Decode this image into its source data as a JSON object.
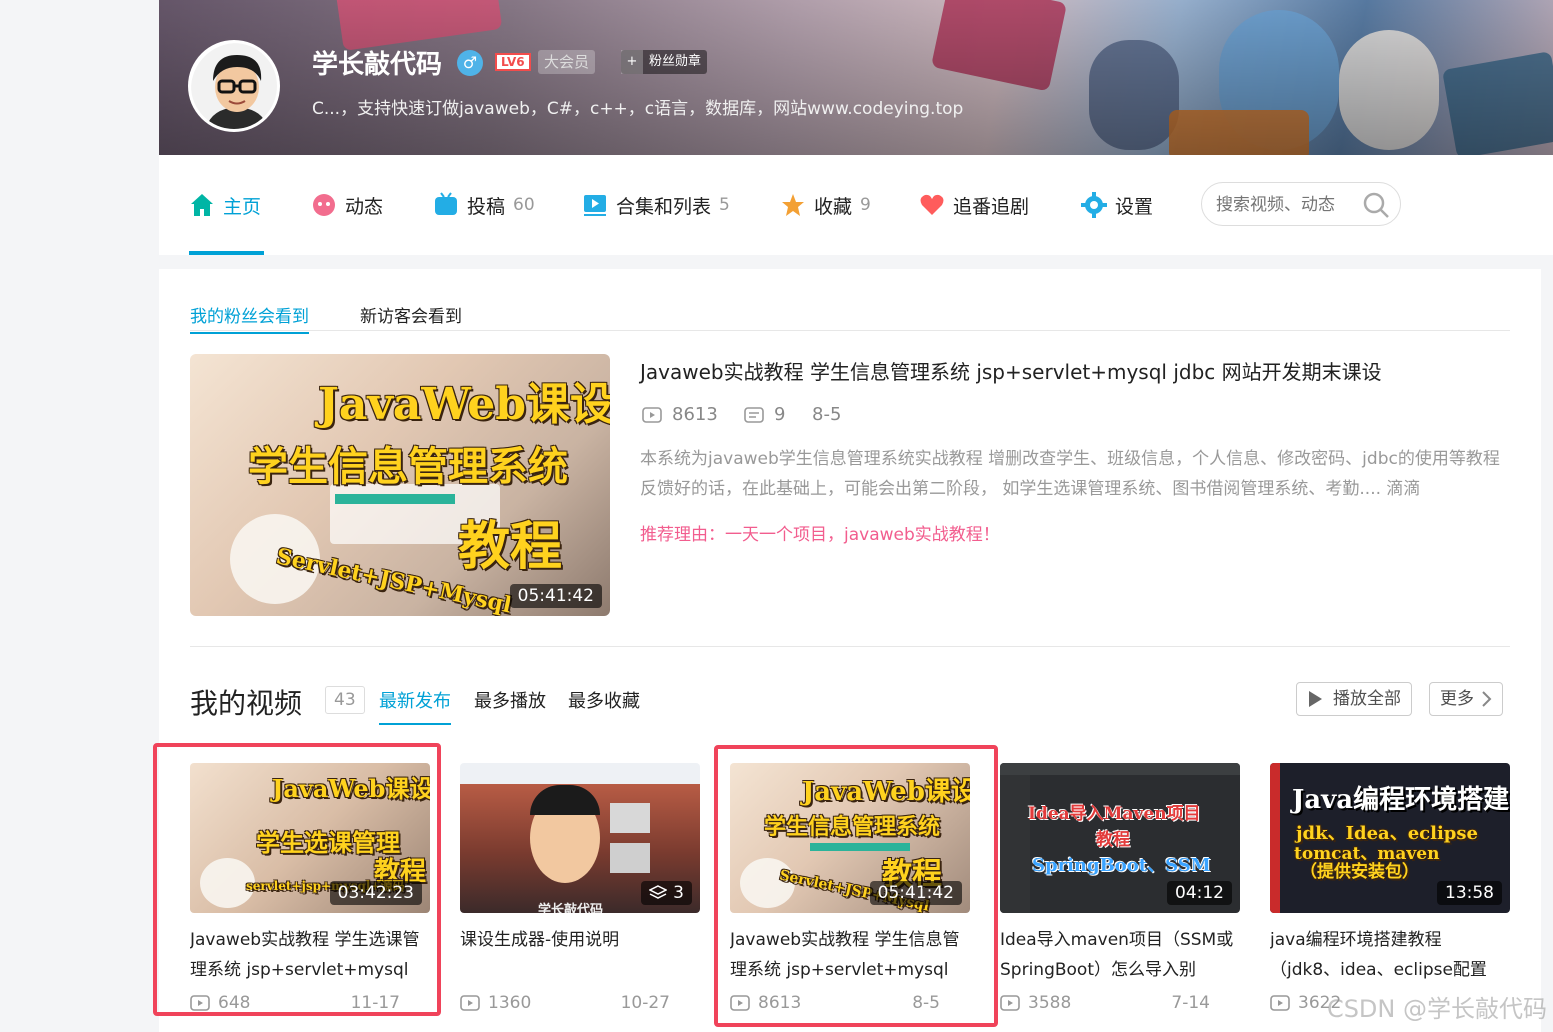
{
  "profile": {
    "username": "学长敲代码",
    "gender_icon": "♂",
    "level_badge": "LV6",
    "vip_badge": "大会员",
    "fans_badge_plus": "+",
    "fans_badge": "粉丝勋章",
    "signature": "C...，支持快速订做javaweb，C#，c++，c语言，数据库，网站www.codeying.top"
  },
  "nav": {
    "home": "主页",
    "dynamic": "动态",
    "posts": "投稿",
    "posts_count": "60",
    "collections": "合集和列表",
    "collections_count": "5",
    "favorites": "收藏",
    "favorites_count": "9",
    "bangumi": "追番追剧",
    "settings": "设置",
    "search_placeholder": "搜索视频、动态"
  },
  "featured": {
    "tab_fans": "我的粉丝会看到",
    "tab_visitors": "新访客会看到",
    "thumb_line1": "JavaWeb课设",
    "thumb_line2": "学生信息管理系统",
    "thumb_line3": "教程",
    "thumb_line4": "Servlet+JSP+Mysql",
    "duration": "05:41:42",
    "title": "Javaweb实战教程 学生信息管理系统 jsp+servlet+mysql jdbc 网站开发期末课设",
    "views": "8613",
    "comments": "9",
    "date": "8-5",
    "description": "本系统为javaweb学生信息管理系统实战教程 增删改查学生、班级信息，个人信息、修改密码、jdbc的使用等教程 反馈好的话，在此基础上，可能会出第二阶段， 如学生选课管理系统、图书借阅管理系统、考勤.... 滴滴",
    "reason": "推荐理由：一天一个项目，javaweb实战教程！"
  },
  "videos_section": {
    "title": "我的视频",
    "count": "43",
    "tab_latest": "最新发布",
    "tab_most_played": "最多播放",
    "tab_most_fav": "最多收藏",
    "play_all": "播放全部",
    "more": "更多"
  },
  "videos": [
    {
      "thumb_line1": "JavaWeb课设",
      "thumb_line2": "学生选课管理",
      "thumb_line3": "教程",
      "thumb_line4": "servlet+jsp+mysql+源码",
      "duration": "03:42:23",
      "title": "Javaweb实战教程 学生选课管理系统 jsp+servlet+mysql",
      "views": "648",
      "date": "11-17"
    },
    {
      "thumb_caption": "学长敲代码",
      "stack_count": "3",
      "title": "课设生成器-使用说明",
      "views": "1360",
      "date": "10-27"
    },
    {
      "thumb_line1": "JavaWeb课设",
      "thumb_line2": "学生信息管理系统",
      "thumb_line3": "教程",
      "thumb_line4": "Servlet+JSP+Mysql",
      "duration": "05:41:42",
      "title": "Javaweb实战教程 学生信息管理系统 jsp+servlet+mysql",
      "views": "8613",
      "date": "8-5"
    },
    {
      "thumb_line1": "Idea导入Maven项目",
      "thumb_line2": "教程",
      "thumb_line3": "SpringBoot、SSM",
      "duration": "04:12",
      "title": "Idea导入maven项目（SSM或SpringBoot）怎么导入别",
      "views": "3588",
      "date": "7-14"
    },
    {
      "thumb_line1": "Java编程环境搭建",
      "thumb_line2": "jdk、Idea、eclipse",
      "thumb_line3": "tomcat、maven",
      "thumb_line4": "（提供安装包）",
      "duration": "13:58",
      "title": "java编程环境搭建教程（jdk8、idea、eclipse配置",
      "views": "3622",
      "date": ""
    }
  ],
  "watermark": "CSDN @学长敲代码",
  "colors": {
    "accent": "#00a1d6",
    "reason": "#f25d8e",
    "highlight_box": "#f0435a"
  }
}
